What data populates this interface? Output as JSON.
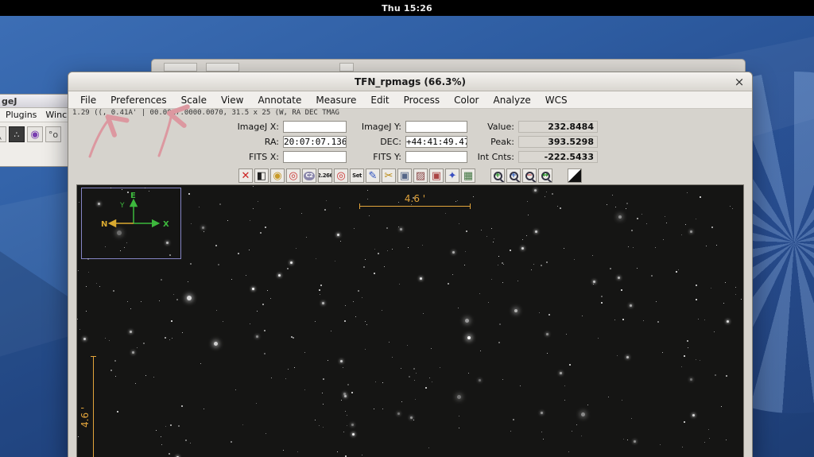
{
  "topbar": {
    "clock": "Thu 15:26"
  },
  "colors": {
    "accent_orange": "#e2a43b",
    "annotation_pink": "#dc98a0",
    "wallpaper_blue": "#2c5a9e",
    "roi_purple": "#8585c5"
  },
  "imagej_window": {
    "title_fragment": "geJ",
    "menus": [
      "Plugins",
      "Winc"
    ],
    "tools": [
      {
        "name": "line-tool-icon",
        "glyph": "╲"
      },
      {
        "name": "active-tool-icon",
        "glyph": "∴",
        "pressed": true
      },
      {
        "name": "color-picker-icon",
        "glyph": "◉",
        "purple": true
      },
      {
        "name": "oval-tool-icon",
        "glyph": "°o"
      }
    ]
  },
  "window": {
    "title": "TFN_rpmags (66.3%)",
    "close_label": "×",
    "menus": [
      "File",
      "Preferences",
      "Scale",
      "View",
      "Annotate",
      "Measure",
      "Edit",
      "Process",
      "Color",
      "Analyze",
      "WCS"
    ],
    "status_line": "1.29 ((, 0.41A' | 00.0017.0000.0070, 31.5 x 25 (W, RA DEC TMAG",
    "info_rows": [
      [
        {
          "label": "ImageJ X:",
          "value": "",
          "kind": "input"
        },
        {
          "label": "ImageJ Y:",
          "value": "",
          "kind": "input"
        },
        {
          "label": "Value:",
          "value": "232.8484",
          "kind": "readout"
        }
      ],
      [
        {
          "label": "RA:",
          "value": "20:07:07.136",
          "kind": "input"
        },
        {
          "label": "DEC:",
          "value": "+44:41:49.47",
          "kind": "input"
        },
        {
          "label": "Peak:",
          "value": "393.5298",
          "kind": "readout"
        }
      ],
      [
        {
          "label": "FITS X:",
          "value": "",
          "kind": "input"
        },
        {
          "label": "FITS Y:",
          "value": "",
          "kind": "input"
        },
        {
          "label": "Int Cnts:",
          "value": "-222.5433",
          "kind": "readout"
        }
      ]
    ],
    "toolbar": {
      "icons": [
        {
          "name": "clear-overlay-icon",
          "type": "glyph",
          "glyph": "✕",
          "color": "#cc2222"
        },
        {
          "name": "invert-lut-icon",
          "type": "glyph",
          "glyph": "◧",
          "color": "#222222"
        },
        {
          "name": "single-aperture-icon",
          "type": "glyph",
          "glyph": "◉",
          "color": "#c89a28"
        },
        {
          "name": "annulus-icon",
          "type": "glyph",
          "glyph": "◎",
          "color": "#cc3333"
        },
        {
          "name": "c2-aperture-icon",
          "type": "text",
          "glyph": "C2",
          "color": "#ffffff",
          "bg": "#8a86aa"
        },
        {
          "name": "aperture-radius-icon",
          "type": "text",
          "glyph": "2.266",
          "color": "#222222"
        },
        {
          "name": "centroid-annulus-icon",
          "type": "glyph",
          "glyph": "◎",
          "color": "#cc3333"
        },
        {
          "name": "set-aperture-icon",
          "type": "text",
          "glyph": "Set",
          "color": "#222222"
        },
        {
          "name": "edit-apertures-icon",
          "type": "glyph",
          "glyph": "✎",
          "color": "#2a4fc0"
        },
        {
          "name": "scissors-icon",
          "type": "glyph",
          "glyph": "✂",
          "color": "#b8860b"
        },
        {
          "name": "copy-region-icon",
          "type": "glyph",
          "glyph": "▣",
          "color": "#556688"
        },
        {
          "name": "stack-tools-icon",
          "type": "glyph",
          "glyph": "▨",
          "color": "#884444"
        },
        {
          "name": "align-stack-icon",
          "type": "glyph",
          "glyph": "▣",
          "color": "#aa4444"
        },
        {
          "name": "star-align-icon",
          "type": "glyph",
          "glyph": "✦",
          "color": "#3a4fc0"
        },
        {
          "name": "measurement-table-icon",
          "type": "glyph",
          "glyph": "▦",
          "color": "#447744"
        },
        {
          "name": "zoom-in-icon",
          "type": "lens",
          "glyph": "+",
          "color": "#118811",
          "gap": true
        },
        {
          "name": "zoom-in-fast-icon",
          "type": "lens",
          "glyph": "+",
          "color": "#2255bb"
        },
        {
          "name": "zoom-out-icon",
          "type": "lens",
          "glyph": "−",
          "color": "#bb3333"
        },
        {
          "name": "zoom-fit-icon",
          "type": "lens",
          "glyph": "↔",
          "color": "#118811"
        },
        {
          "name": "negative-display-icon",
          "type": "split",
          "glyph": "",
          "color": "",
          "gap": true
        }
      ]
    },
    "image": {
      "h_scale_label": "4.6 '",
      "v_scale_label": "4.6 '",
      "compass": {
        "n": "N",
        "e": "E",
        "x": "X",
        "y": "Y"
      }
    }
  },
  "starfield": {
    "seed": 1337,
    "count": 380
  }
}
